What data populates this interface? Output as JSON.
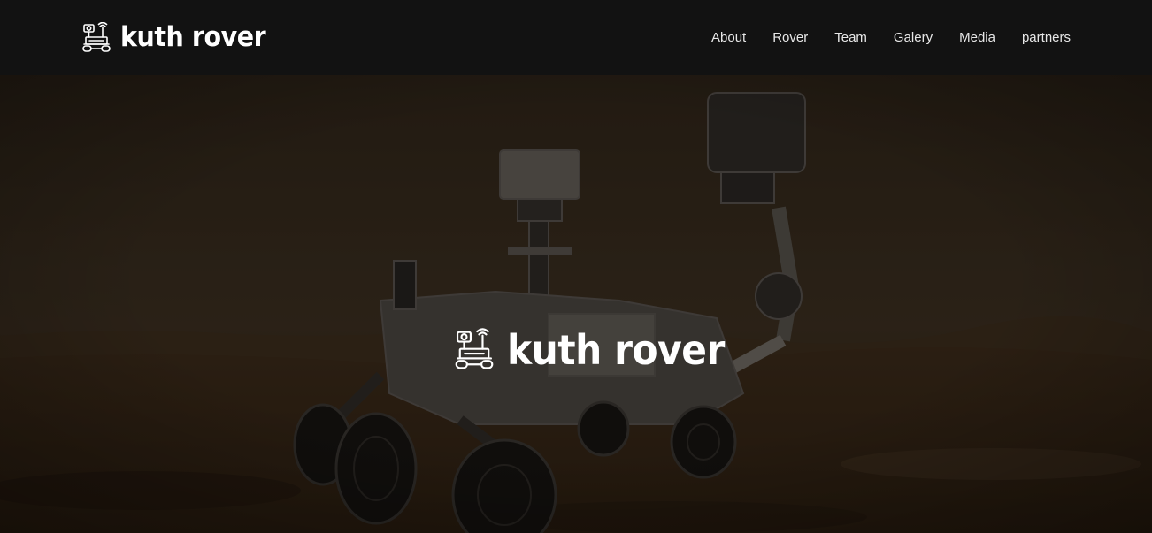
{
  "header": {
    "brand_name": "kuth rover",
    "logo_icon": "rover-robot-icon",
    "nav": [
      {
        "label": "About"
      },
      {
        "label": "Rover"
      },
      {
        "label": "Team"
      },
      {
        "label": "Galery"
      },
      {
        "label": "Media"
      },
      {
        "label": "partners"
      }
    ]
  },
  "hero": {
    "brand_name": "kuth rover",
    "logo_icon": "rover-robot-icon",
    "background": "mars-rover-photo"
  },
  "colors": {
    "navbar_bg": "#121212",
    "text": "#ffffff",
    "overlay": "#000000"
  }
}
